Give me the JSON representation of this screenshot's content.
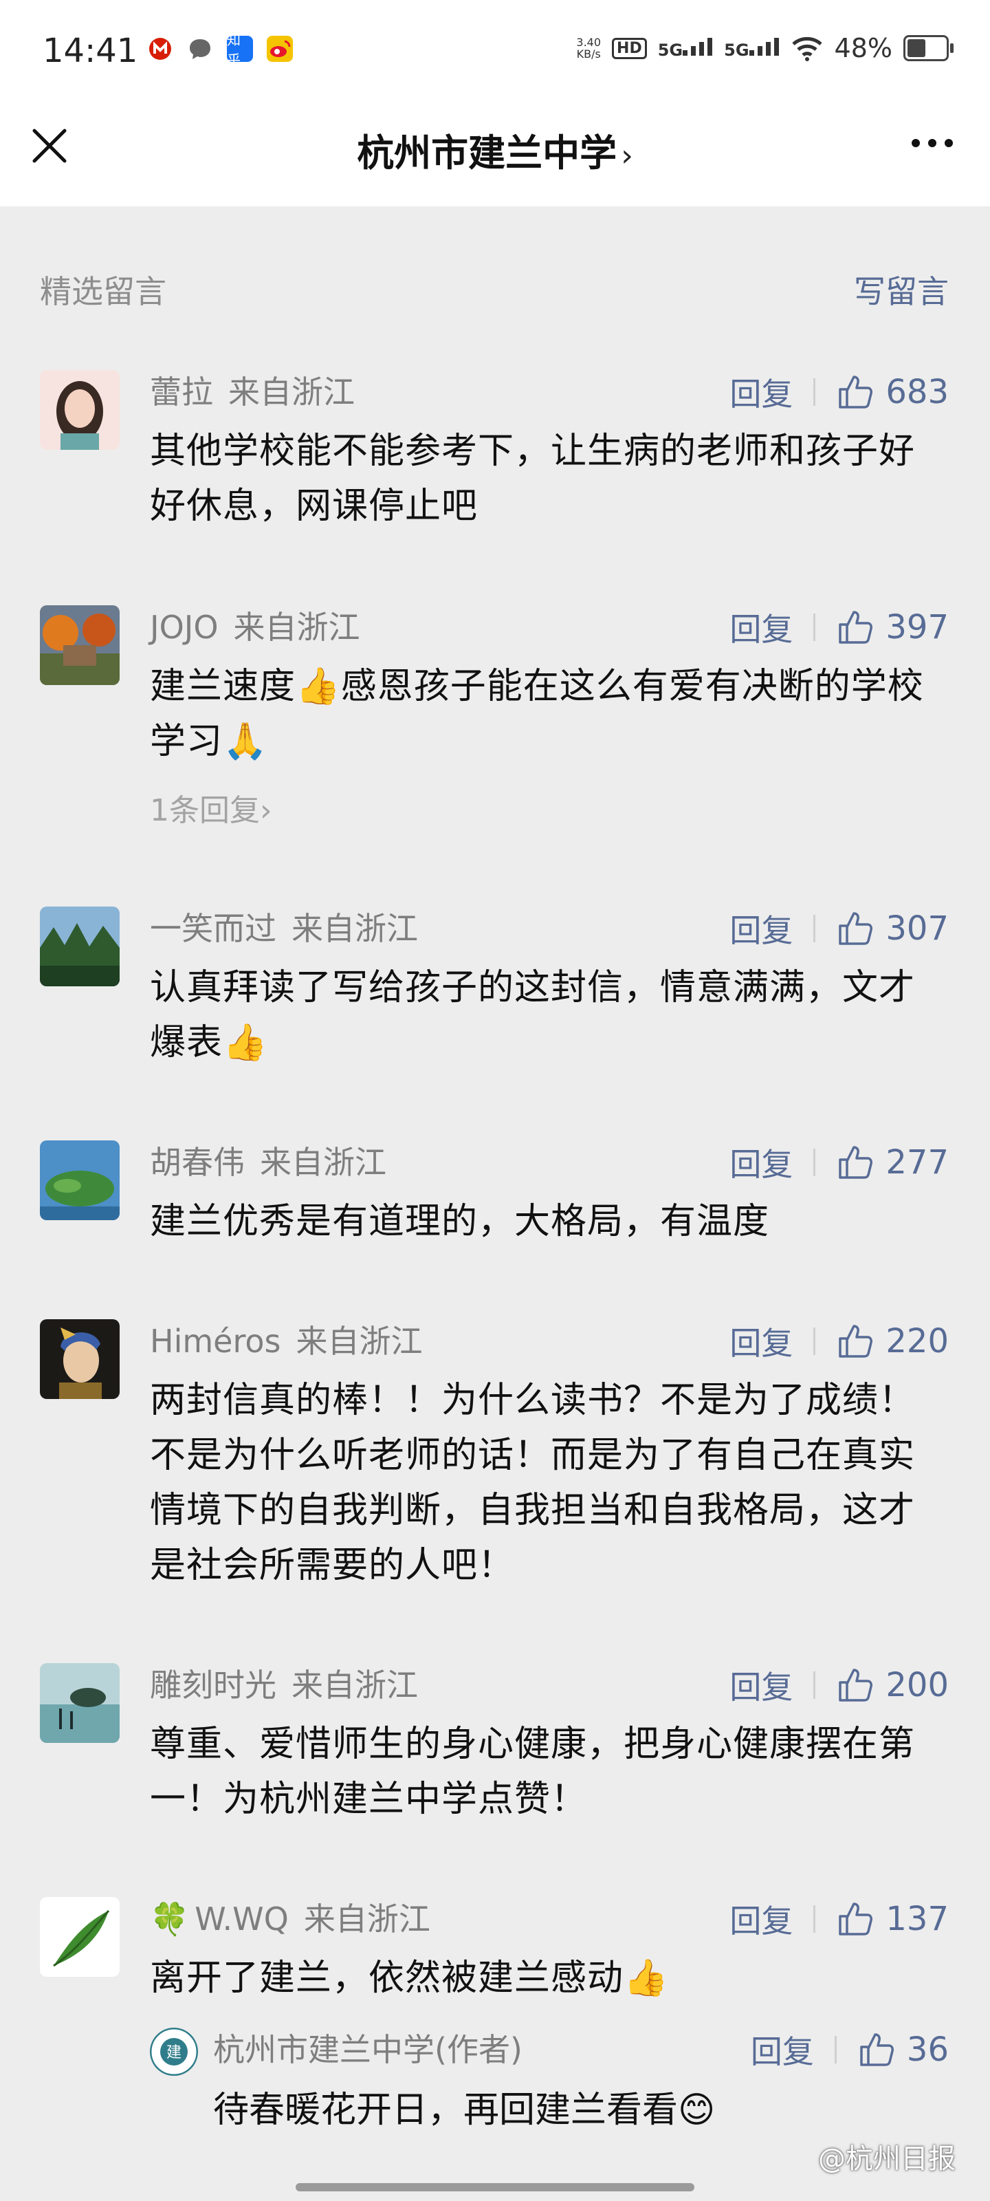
{
  "status_bar": {
    "time": "14:41",
    "notification_icons": [
      "mi-icon",
      "message-icon",
      "zhihu-icon",
      "weibo-icon"
    ],
    "zhihu_label": "知乎",
    "net_speed_value": "3.40",
    "net_speed_unit": "KB/s",
    "hd_badge": "HD",
    "signal_1": "5G",
    "signal_2": "5G",
    "battery_pct": "48%",
    "battery_level": 0.48
  },
  "nav": {
    "title": "杭州市建兰中学",
    "chevron": "›"
  },
  "section": {
    "title": "精选留言",
    "write_label": "写留言"
  },
  "reply_label": "回复",
  "comments": [
    {
      "name": "蕾拉",
      "location": "来自浙江",
      "likes": "683",
      "text": "其他学校能不能参考下，让生病的老师和孩子好好休息，网课停止吧"
    },
    {
      "name": "JOJO",
      "location": "来自浙江",
      "likes": "397",
      "text": "建兰速度👍感恩孩子能在这么有爱有决断的学校学习🙏",
      "more_replies": "1条回复›"
    },
    {
      "name": "一笑而过",
      "location": "来自浙江",
      "likes": "307",
      "text": "认真拜读了写给孩子的这封信，情意满满，文才爆表👍"
    },
    {
      "name": "胡春伟",
      "location": "来自浙江",
      "likes": "277",
      "text": "建兰优秀是有道理的，大格局，有温度"
    },
    {
      "name": "Himéros",
      "location": "来自浙江",
      "likes": "220",
      "text": "两封信真的棒！！为什么读书？不是为了成绩！不是为什么听老师的话！而是为了有自己在真实情境下的自我判断，自我担当和自我格局，这才是社会所需要的人吧！"
    },
    {
      "name": "雕刻时光",
      "location": "来自浙江",
      "likes": "200",
      "text": "尊重、爱惜师生的身心健康，把身心健康摆在第一！为杭州建兰中学点赞！"
    },
    {
      "name": "W.WQ",
      "name_prefix": "🍀",
      "location": "来自浙江",
      "likes": "137",
      "text": "离开了建兰，依然被建兰感动👍"
    }
  ],
  "author_reply": {
    "name": "杭州市建兰中学(作者)",
    "likes": "36",
    "text": "待春暖花开日，再回建兰看看😊"
  },
  "watermark": "@杭州日报"
}
